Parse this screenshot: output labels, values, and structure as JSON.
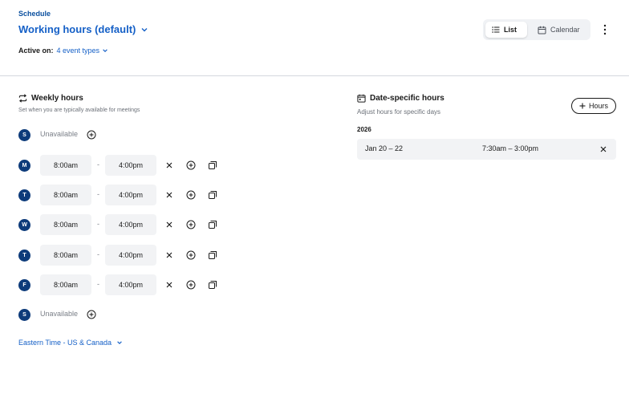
{
  "header": {
    "breadcrumb": "Schedule",
    "title": "Working hours (default)",
    "active_label": "Active on:",
    "active_link": "4 event types",
    "view_toggle": {
      "list": "List",
      "calendar": "Calendar",
      "selected": "List"
    }
  },
  "weekly": {
    "title": "Weekly hours",
    "subtitle": "Set when you are typically available for meetings",
    "days": [
      {
        "letter": "S",
        "unavailable": "Unavailable"
      },
      {
        "letter": "M",
        "start": "8:00am",
        "end": "4:00pm"
      },
      {
        "letter": "T",
        "start": "8:00am",
        "end": "4:00pm"
      },
      {
        "letter": "W",
        "start": "8:00am",
        "end": "4:00pm"
      },
      {
        "letter": "T",
        "start": "8:00am",
        "end": "4:00pm"
      },
      {
        "letter": "F",
        "start": "8:00am",
        "end": "4:00pm"
      },
      {
        "letter": "S",
        "unavailable": "Unavailable"
      }
    ],
    "dash": "-",
    "timezone": "Eastern Time - US & Canada"
  },
  "date_specific": {
    "title": "Date-specific hours",
    "subtitle": "Adjust hours for specific days",
    "add_button": "Hours",
    "year": "2026",
    "overrides": [
      {
        "dates": "Jan 20 – 22",
        "hours": "7:30am – 3:00pm"
      }
    ]
  },
  "colors": {
    "accent": "#1560c7",
    "badge": "#0d3b7a",
    "input_bg": "#f2f3f5"
  }
}
